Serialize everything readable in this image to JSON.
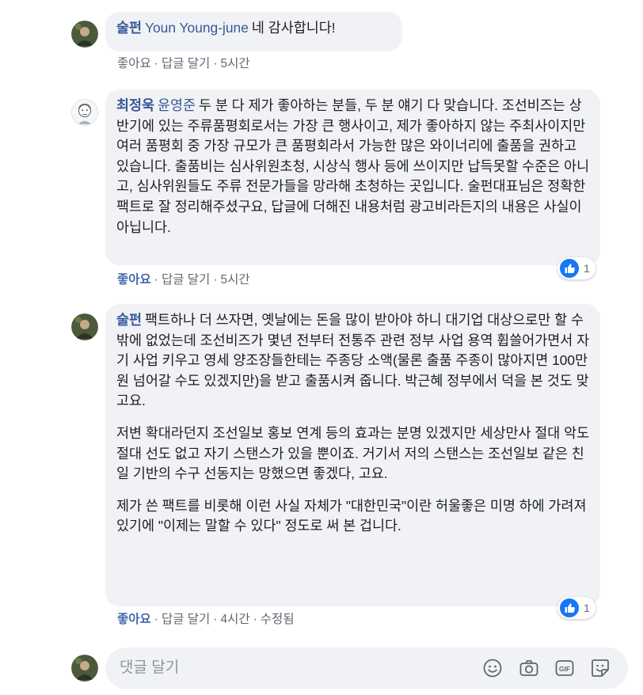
{
  "comments": [
    {
      "author": "술펀",
      "mention": "Youn Young-june",
      "paragraphs": [
        "네 감사합니다!"
      ],
      "actions": {
        "like": "좋아요",
        "reply": "답글 달기",
        "time": "5시간"
      }
    },
    {
      "author": "최정욱",
      "mention": "윤영준",
      "paragraphs": [
        "두 분 다 제가 좋아하는 분들, 두 분 얘기 다 맞습니다. 조선비즈는 상반기에 있는 주류품평회로서는 가장 큰 행사이고, 제가 좋아하지 않는 주최사이지만 여러 품평회 중 가장 규모가 큰 품평회라서 가능한 많은 와이너리에 출품을 권하고 있습니다. 출품비는 심사위원초청, 시상식 행사 등에 쓰이지만 납득못할 수준은 아니고, 심사위원들도 주류 전문가들을 망라해 초청하는 곳입니다. 술펀대표님은 정확한 팩트로 잘 정리해주셨구요, 답글에 더해진 내용처럼 광고비라든지의 내용은 사실이 아닙니다."
      ],
      "actions": {
        "like": "좋아요",
        "reply": "답글 달기",
        "time": "5시간"
      },
      "reaction_count": "1"
    },
    {
      "author": "술펀",
      "paragraphs": [
        "팩트하나 더 쓰자면, 옛날에는 돈을 많이 받아야 하니 대기업 대상으로만 할 수 밖에 없었는데 조선비즈가 몇년 전부터 전통주 관련 정부 사업 용역 휩쓸어가면서 자기 사업 키우고 영세 양조장들한테는 주종당 소액(물론 출품 주종이 많아지면 100만원 넘어갈 수도 있겠지만)을 받고 출품시켜 줍니다. 박근혜 정부에서 덕을 본 것도 맞고요.",
        "저변 확대라던지 조선일보 홍보 연계 등의 효과는 분명 있겠지만 세상만사 절대 악도 절대 선도 없고 자기 스탠스가 있을 뿐이죠. 거기서 저의 스탠스는 조선일보 같은 친일 기반의 수구 선동지는 망했으면 좋겠다, 고요.",
        "제가 쓴 팩트를 비롯해 이런 사실 자체가 \"대한민국\"이란 허울좋은 미명 하에 가려져 있기에 \"이제는 말할 수 있다\" 정도로 써 본 겁니다."
      ],
      "actions": {
        "like": "좋아요",
        "reply": "답글 달기",
        "time": "4시간",
        "edited": "수정됨"
      },
      "reaction_count": "1"
    }
  ],
  "separator": "·",
  "composer": {
    "placeholder": "댓글 달기",
    "icons": [
      "emoji-icon",
      "camera-icon",
      "gif-icon",
      "sticker-icon"
    ]
  },
  "colors": {
    "name": "#385898",
    "liked": "#4267b2",
    "bubble": "#f0f2f5",
    "meta": "#606770"
  }
}
